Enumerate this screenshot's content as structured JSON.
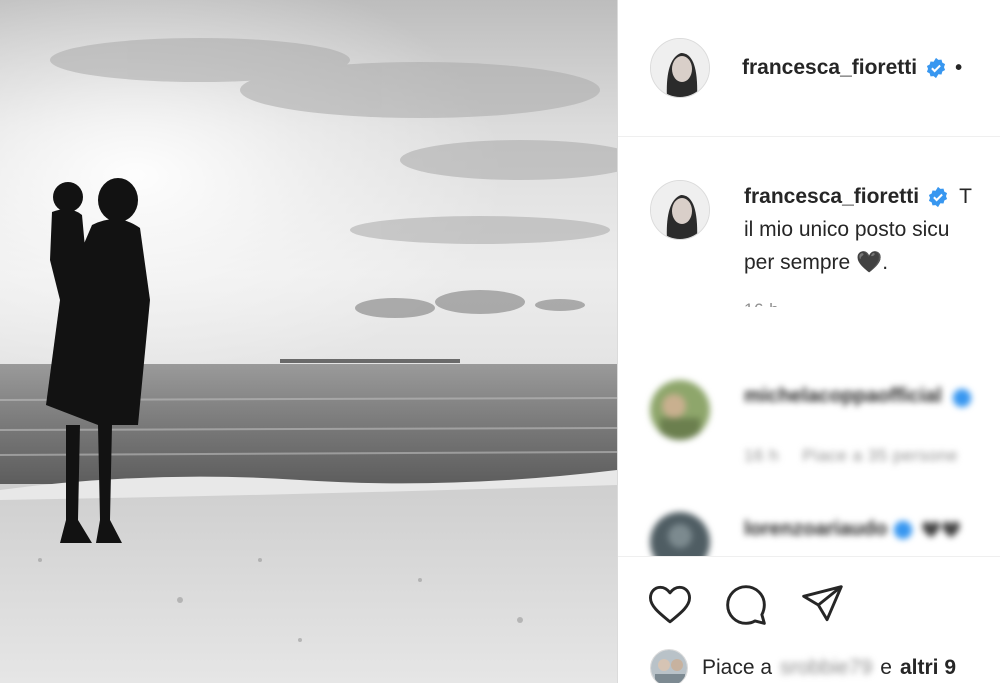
{
  "post": {
    "author": "francesca_fioretti",
    "dot": "•",
    "caption_lines": [
      "T",
      "il mio unico posto sicu",
      "per sempre 🖤."
    ],
    "caption_time": "16 h"
  },
  "comments": [
    {
      "user": "michelacoppaofficial",
      "meta_time": "16 h",
      "meta_likes": "Piace a 35 persone"
    },
    {
      "user": "lorenzoariaudo",
      "text": "🖤🖤"
    }
  ],
  "actions": {
    "like_icon": "heart-icon",
    "comment_icon": "comment-icon",
    "share_icon": "share-icon"
  },
  "likes": {
    "prefix": "Piace a",
    "user": "srobbie79",
    "middle": "e",
    "others": "altri 9"
  },
  "colors": {
    "verified": "#3897f0",
    "text": "#262626",
    "muted": "#8e8e8e"
  }
}
